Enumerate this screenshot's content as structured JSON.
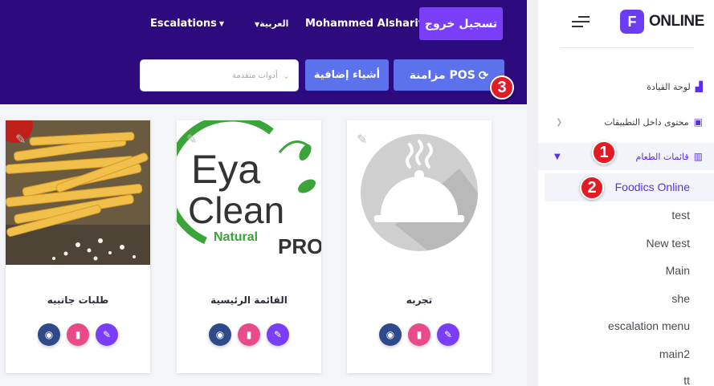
{
  "header": {
    "escalations_label": "Escalations",
    "language_label": "العربية",
    "user_name": "Mohammed Alsharif",
    "logout_label": "تسجيل خروج",
    "sync_label": "مزامنة POS",
    "extras_label": "أشياء إضافية",
    "tools_placeholder": "أدوات متقدمة"
  },
  "cards": [
    {
      "title": "تجربه",
      "image": "cloche-icon"
    },
    {
      "title": "القائمة الرئيسية",
      "image": "eya-clean-logo",
      "logo_lines": [
        "Eya",
        "Clean",
        "Natural",
        "PRO"
      ]
    },
    {
      "title": "طلبات جانبيه",
      "image": "french-fries-photo"
    }
  ],
  "sidebar": {
    "brand": "ONLINE",
    "brand_mark": "F",
    "dashboard": "لوحة القيادة",
    "in_app_content": "محتوى داخل التطبيقات",
    "menus": "قائمات الطعام",
    "submenu": [
      "Foodics Online",
      "test",
      "New test",
      "Main",
      "she",
      "escalation menu",
      "main2",
      "tt"
    ]
  },
  "annotations": [
    "1",
    "2",
    "3"
  ],
  "colors": {
    "topbar": "#2d0a7e",
    "accent": "#7b3ef8",
    "button_blue": "#5c71ec",
    "badge_red": "#e11c24"
  }
}
